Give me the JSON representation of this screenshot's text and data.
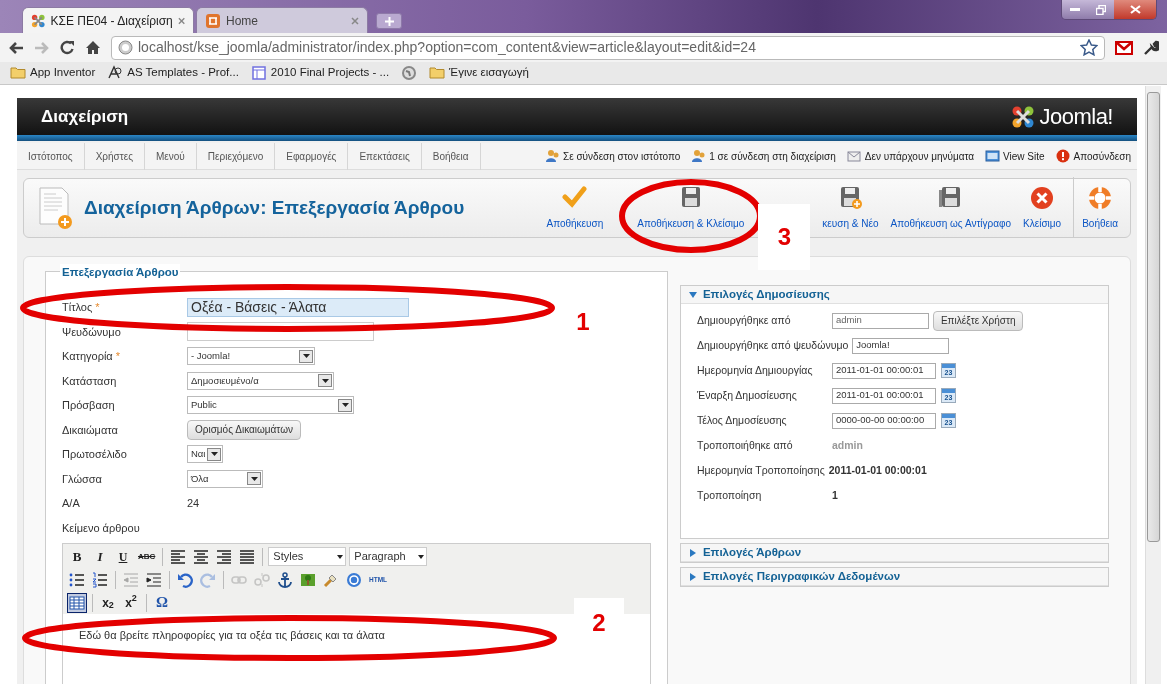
{
  "browser": {
    "tabs": [
      {
        "title": "ΚΣΕ ΠΕ04 - Διαχείριση",
        "selected": true,
        "kind": "joomla"
      },
      {
        "title": "Home",
        "selected": false,
        "kind": "home"
      }
    ],
    "url": "localhost/kse_joomla/administrator/index.php?option=com_content&view=article&layout=edit&id=24",
    "bookmarks": [
      {
        "label": "App  Inventor",
        "kind": "folder"
      },
      {
        "label": "AS Templates - Prof...",
        "kind": "as"
      },
      {
        "label": "2010 Final Projects - ...",
        "kind": "page"
      },
      {
        "kind": "globe"
      },
      {
        "label": "Έγινε εισαγωγή",
        "kind": "folder"
      }
    ]
  },
  "header": {
    "title": "Διαχείριση",
    "logo": "Joomla!"
  },
  "menu": {
    "items": [
      "Ιστότοπος",
      "Χρήστες",
      "Μενού",
      "Περιεχόμενο",
      "Εφαρμογές",
      "Επεκτάσεις",
      "Βοήθεια"
    ],
    "status": [
      {
        "label": "Σε σύνδεση στον ιστότοπο",
        "kind": "users"
      },
      {
        "label": "1 σε σύνδεση στη διαχείριση",
        "kind": "users"
      },
      {
        "label": "Δεν υπάρχουν μηνύματα",
        "kind": "mail"
      },
      {
        "label": "View Site",
        "kind": "site"
      },
      {
        "label": "Αποσύνδεση",
        "kind": "logout"
      }
    ]
  },
  "toolbar": {
    "title": "Διαχείριση Άρθρων: Επεξεργασία Άρθρου",
    "buttons": [
      {
        "label": "Αποθήκευση",
        "kind": "apply"
      },
      {
        "label": "Αποθήκευση & Κλείσιμο",
        "kind": "save"
      },
      {
        "label": "κευση & Νέο",
        "kind": "save-new"
      },
      {
        "label": "Αποθήκευση ως Αντίγραφο",
        "kind": "save-copy"
      },
      {
        "label": "Κλείσιμο",
        "kind": "cancel"
      },
      {
        "label": "Βοήθεια",
        "kind": "help"
      }
    ]
  },
  "form": {
    "legend": "Επεξεργασία Άρθρου",
    "fields": [
      {
        "label": "Τίτλος",
        "marker": "*",
        "kind": "text",
        "value": "Οξέα - Βάσεις - Άλατα",
        "focused": true
      },
      {
        "label": "Ψευδώνυμο",
        "kind": "text",
        "focused": false
      },
      {
        "label": "Κατηγορία",
        "marker": "*",
        "kind": "select",
        "value": "- Joomla!",
        "focused": false
      },
      {
        "label": "Κατάσταση",
        "kind": "select",
        "value": "Δημοσιευμένο/α",
        "focused": false
      },
      {
        "label": "Πρόσβαση",
        "kind": "select",
        "value": "Public",
        "focused": false
      },
      {
        "label": "Δικαιώματα",
        "kind": "button",
        "value": "Ορισμός Δικαιωμάτων",
        "focused": false
      },
      {
        "label": "Πρωτοσέλιδο",
        "kind": "select",
        "value": "Ναι",
        "focused": false
      },
      {
        "label": "Γλώσσα",
        "kind": "select",
        "value": "Όλα",
        "focused": false
      },
      {
        "label": "Α/Α",
        "kind": "static",
        "value": "24"
      }
    ],
    "editor": {
      "label": "Κείμενο άρθρου",
      "rows": [
        [
          {
            "kind": "bold",
            "label": "B",
            "disabled": false
          },
          {
            "kind": "italic",
            "label": "I",
            "disabled": false
          },
          {
            "kind": "underline",
            "label": "U",
            "disabled": false
          },
          {
            "kind": "strike",
            "label": "ABC",
            "disabled": false
          },
          {
            "kind": "sep"
          },
          {
            "kind": "align-left",
            "disabled": false
          },
          {
            "kind": "align-center",
            "disabled": false
          },
          {
            "kind": "align-right",
            "disabled": false
          },
          {
            "kind": "justify",
            "disabled": false
          },
          {
            "kind": "sep"
          },
          {
            "kind": "select",
            "label": "Styles",
            "disabled": false
          },
          {
            "kind": "select",
            "label": "Paragraph",
            "disabled": false
          }
        ],
        [
          {
            "kind": "bullets",
            "disabled": false
          },
          {
            "kind": "numbers",
            "disabled": false
          },
          {
            "kind": "sep"
          },
          {
            "kind": "outdent",
            "disabled": true
          },
          {
            "kind": "indent",
            "disabled": false
          },
          {
            "kind": "sep"
          },
          {
            "kind": "undo",
            "disabled": false
          },
          {
            "kind": "redo",
            "disabled": true
          },
          {
            "kind": "sep"
          },
          {
            "kind": "link",
            "disabled": true
          },
          {
            "kind": "unlink",
            "disabled": true
          },
          {
            "kind": "anchor",
            "disabled": false
          },
          {
            "kind": "image",
            "disabled": false
          },
          {
            "kind": "cleanup",
            "disabled": false
          },
          {
            "kind": "help",
            "disabled": false
          },
          {
            "kind": "html",
            "label": "HTML",
            "disabled": false
          }
        ],
        [
          {
            "kind": "table",
            "disabled": false,
            "selected": true
          },
          {
            "kind": "sep"
          },
          {
            "kind": "sub",
            "label": "x$_{2}$",
            "disabled": false
          },
          {
            "kind": "sup",
            "label": "x$^{2}$",
            "disabled": false
          },
          {
            "kind": "sep"
          },
          {
            "kind": "char",
            "label": "Ω",
            "disabled": false
          }
        ]
      ],
      "content": "Εδώ θα βρείτε πληροφορίες για τα οξέα τις βάσεις και τα άλατα"
    }
  },
  "panels": [
    {
      "title": "Επιλογές Δημοσίευσης",
      "expanded": true,
      "rows": [
        {
          "label": "Δημιουργήθηκε από",
          "kind": "field-button",
          "value": "admin",
          "button": "Επιλέξτε Χρήστη"
        },
        {
          "label": "Δημιουργήθηκε από ψευδώνυμο",
          "kind": "field",
          "value": "Joomla!"
        },
        {
          "label": "Ημερομηνία Δημιουργίας",
          "kind": "date",
          "value": "2011-01-01 00:00:01",
          "calendar": "23"
        },
        {
          "label": "Έναρξη Δημοσίευσης",
          "kind": "date",
          "value": "2011-01-01 00:00:01",
          "calendar": "23"
        },
        {
          "label": "Τέλος Δημοσίευσης",
          "kind": "date",
          "value": "0000-00-00 00:00:00",
          "calendar": "23"
        },
        {
          "label": "Τροποποιήθηκε από",
          "kind": "muted",
          "value": "admin"
        },
        {
          "label": "Ημερομηνία Τροποποίησης",
          "kind": "static",
          "value": "2011-01-01 00:00:01"
        },
        {
          "label": "Τροποποίηση",
          "kind": "static",
          "value": "1"
        }
      ]
    },
    {
      "title": "Επιλογές Άρθρων",
      "expanded": false
    },
    {
      "title": "Επιλογές Περιγραφικών Δεδομένων",
      "expanded": false
    }
  ],
  "annotations": [
    {
      "number": "1"
    },
    {
      "number": "2"
    },
    {
      "number": "3"
    }
  ]
}
